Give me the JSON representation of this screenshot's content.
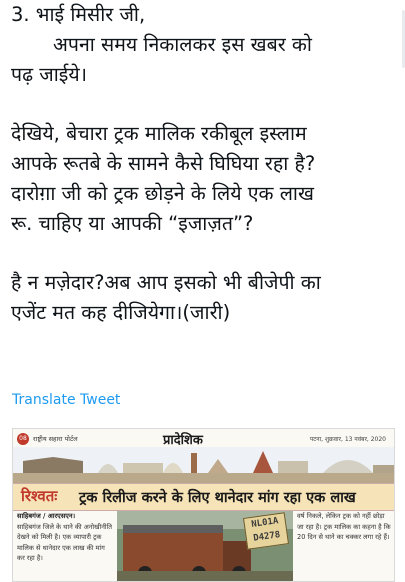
{
  "tweet": {
    "lines": [
      "3. भाई मिसीर जी,",
      "अपना समय निकालकर इस खबर को",
      "पढ़ जाईये।",
      "",
      "देखिये, बेचारा ट्रक मालिक रकीबूल इस्लाम",
      "आपके रूतबे के सामने कैसे घिघिया रहा है?",
      "दारोग़ा जी को ट्रक छोड़ने के लिये एक लाख",
      "रू. चाहिए या आपकी “इजाज़त”?",
      "",
      "है न मज़ेदार?अब आप इसको भी बीजेपी का",
      "एजेंट मत कह दीजियेगा।(जारी)"
    ],
    "translate_label": "Translate Tweet"
  },
  "clipping": {
    "page_number": "08",
    "paper_name": "राष्ट्रीय सहारा पोर्टल",
    "section": "प्रादेशिक",
    "dateline": "पटना, शुक्रवार, 13 नवंबर, 2020",
    "headline_tag": "रिश्वतः",
    "headline": "ट्रक रिलीज करने के लिए थानेदार मांग रहा एक लाख",
    "byline": "साहिबगंज / आरएसएन।",
    "left_column": "साहिबगंज जिले के थाने की अनोखीनीति देखने को मिली है। एक व्यापारी ट्रक मालिक से थानेदार एक लाख की मांग कर रहा है।",
    "right_column": "वर्ष निकले, लेकिन ट्रक को नहीं छोड़ा जा रहा है। ट्रक मालिक का कहना है कि 20 दिन से थाने का चक्कर लगा रहे हैं।",
    "plate_text": "NL01A D4278"
  },
  "colors": {
    "text": "#0f1419",
    "link": "#1d9bf0",
    "headline_red": "#c0392b",
    "headline_band": "#f6e4b8"
  }
}
